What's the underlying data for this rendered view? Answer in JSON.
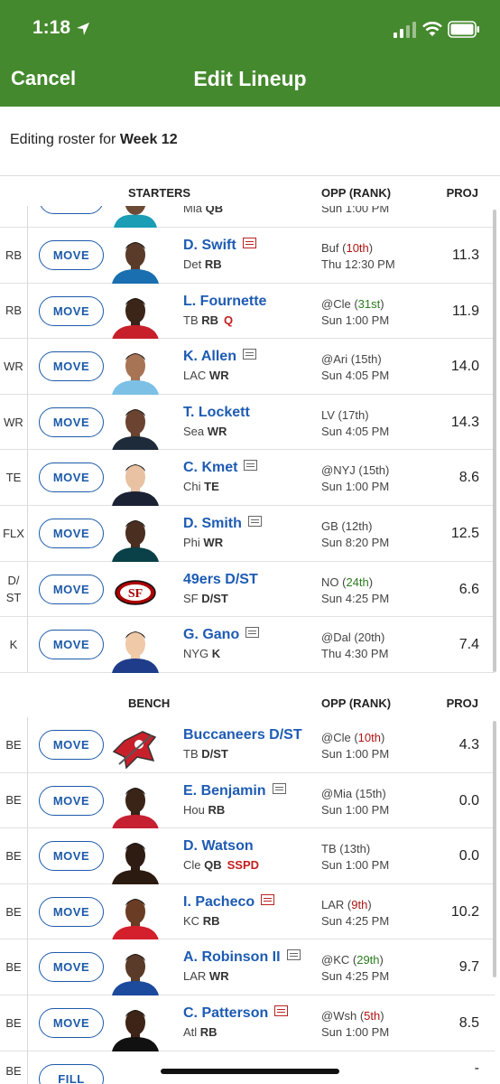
{
  "status_bar": {
    "time": "1:18"
  },
  "nav": {
    "cancel": "Cancel",
    "title": "Edit Lineup"
  },
  "editing": {
    "prefix": "Editing roster for",
    "week": "Week 12"
  },
  "starters_header": {
    "label": "STARTERS",
    "opp": "OPP (RANK)",
    "proj": "PROJ"
  },
  "bench_header": {
    "label": "BENCH",
    "opp": "OPP (RANK)",
    "proj": "PROJ"
  },
  "partial_top": {
    "team": "Mia",
    "pos": "QB",
    "time": "Sun 1:00 PM"
  },
  "starters": [
    {
      "slot": "RB",
      "button": "MOVE",
      "name": "D. Swift",
      "news": "red",
      "team": "Det",
      "pos": "RB",
      "status": "",
      "opp": "Buf",
      "rank": "10th",
      "rank_color": "red",
      "time": "Thu 12:30 PM",
      "proj": "11.3",
      "avatar": "player-avatar-lions"
    },
    {
      "slot": "RB",
      "button": "MOVE",
      "name": "L. Fournette",
      "news": "",
      "team": "TB",
      "pos": "RB",
      "status": "Q",
      "opp": "@Cle",
      "rank": "31st",
      "rank_color": "green",
      "time": "Sun 1:00 PM",
      "proj": "11.9",
      "avatar": "player-avatar-bucs"
    },
    {
      "slot": "WR",
      "button": "MOVE",
      "name": "K. Allen",
      "news": "gray",
      "team": "LAC",
      "pos": "WR",
      "status": "",
      "opp": "@Ari",
      "rank": "15th",
      "rank_color": "normal",
      "time": "Sun 4:05 PM",
      "proj": "14.0",
      "avatar": "player-avatar-chargers"
    },
    {
      "slot": "WR",
      "button": "MOVE",
      "name": "T. Lockett",
      "news": "",
      "team": "Sea",
      "pos": "WR",
      "status": "",
      "opp": "LV",
      "rank": "17th",
      "rank_color": "normal",
      "time": "Sun 4:05 PM",
      "proj": "14.3",
      "avatar": "player-avatar-seahawks"
    },
    {
      "slot": "TE",
      "button": "MOVE",
      "name": "C. Kmet",
      "news": "gray",
      "team": "Chi",
      "pos": "TE",
      "status": "",
      "opp": "@NYJ",
      "rank": "15th",
      "rank_color": "normal",
      "time": "Sun 1:00 PM",
      "proj": "8.6",
      "avatar": "player-avatar-bears"
    },
    {
      "slot": "FLX",
      "button": "MOVE",
      "name": "D. Smith",
      "news": "gray",
      "team": "Phi",
      "pos": "WR",
      "status": "",
      "opp": "GB",
      "rank": "12th",
      "rank_color": "normal",
      "time": "Sun 8:20 PM",
      "proj": "12.5",
      "avatar": "player-avatar-eagles"
    },
    {
      "slot": "D/\nST",
      "button": "MOVE",
      "name": "49ers D/ST",
      "news": "",
      "team": "SF",
      "pos": "D/ST",
      "status": "",
      "opp": "NO",
      "rank": "24th",
      "rank_color": "green",
      "time": "Sun 4:25 PM",
      "proj": "6.6",
      "avatar": "logo-49ers"
    },
    {
      "slot": "K",
      "button": "MOVE",
      "name": "G. Gano",
      "news": "gray",
      "team": "NYG",
      "pos": "K",
      "status": "",
      "opp": "@Dal",
      "rank": "20th",
      "rank_color": "normal",
      "time": "Thu 4:30 PM",
      "proj": "7.4",
      "avatar": "player-avatar-giants"
    }
  ],
  "bench": [
    {
      "slot": "BE",
      "button": "MOVE",
      "name": "Buccaneers D/ST",
      "news": "",
      "team": "TB",
      "pos": "D/ST",
      "status": "",
      "opp": "@Cle",
      "rank": "10th",
      "rank_color": "red",
      "time": "Sun 1:00 PM",
      "proj": "4.3",
      "avatar": "logo-buccaneers"
    },
    {
      "slot": "BE",
      "button": "MOVE",
      "name": "E. Benjamin",
      "news": "gray",
      "team": "Hou",
      "pos": "RB",
      "status": "",
      "opp": "@Mia",
      "rank": "15th",
      "rank_color": "normal",
      "time": "Sun 1:00 PM",
      "proj": "0.0",
      "avatar": "player-avatar-texans"
    },
    {
      "slot": "BE",
      "button": "MOVE",
      "name": "D. Watson",
      "news": "",
      "team": "Cle",
      "pos": "QB",
      "status": "SSPD",
      "opp": "TB",
      "rank": "13th",
      "rank_color": "normal",
      "time": "Sun 1:00 PM",
      "proj": "0.0",
      "avatar": "player-avatar-browns"
    },
    {
      "slot": "BE",
      "button": "MOVE",
      "name": "I. Pacheco",
      "news": "red",
      "team": "KC",
      "pos": "RB",
      "status": "",
      "opp": "LAR",
      "rank": "9th",
      "rank_color": "red",
      "time": "Sun 4:25 PM",
      "proj": "10.2",
      "avatar": "player-avatar-chiefs"
    },
    {
      "slot": "BE",
      "button": "MOVE",
      "name": "A. Robinson II",
      "news": "gray",
      "team": "LAR",
      "pos": "WR",
      "status": "",
      "opp": "@KC",
      "rank": "29th",
      "rank_color": "green",
      "time": "Sun 4:25 PM",
      "proj": "9.7",
      "avatar": "player-avatar-rams"
    },
    {
      "slot": "BE",
      "button": "MOVE",
      "name": "C. Patterson",
      "news": "red",
      "team": "Atl",
      "pos": "RB",
      "status": "",
      "opp": "@Wsh",
      "rank": "5th",
      "rank_color": "red",
      "time": "Sun 1:00 PM",
      "proj": "8.5",
      "avatar": "player-avatar-falcons"
    }
  ],
  "partial_bottom": {
    "slot": "BE",
    "button": "FILL",
    "opp": "-",
    "proj": "-"
  },
  "colors": {
    "header_green": "#45892e",
    "link_blue": "#1d5bb3",
    "rank_red": "#b01414",
    "rank_green": "#2b7d1e"
  }
}
